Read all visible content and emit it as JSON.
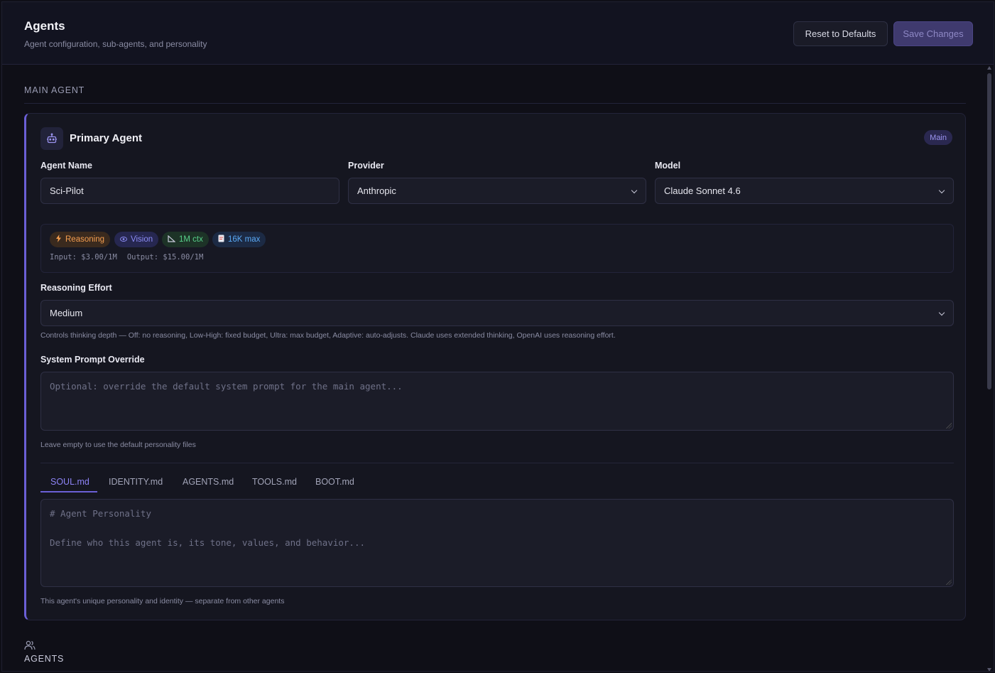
{
  "header": {
    "title": "Agents",
    "subtitle": "Agent configuration, sub-agents, and personality",
    "reset_label": "Reset to Defaults",
    "save_label": "Save Changes"
  },
  "main_section": {
    "label": "MAIN AGENT"
  },
  "primary_agent": {
    "title": "Primary Agent",
    "badge": "Main",
    "icon": "robot-icon",
    "name_label": "Agent Name",
    "name_value": "Sci-Pilot",
    "provider_label": "Provider",
    "provider_value": "Anthropic",
    "model_label": "Model",
    "model_value": "Claude Sonnet 4.6",
    "capabilities": {
      "reasoning": "Reasoning",
      "vision": "Vision",
      "context": "1M ctx",
      "max": "16K max",
      "input_price": "Input: $3.00/1M",
      "output_price": "Output: $15.00/1M"
    },
    "reasoning_label": "Reasoning Effort",
    "reasoning_value": "Medium",
    "reasoning_help": "Controls thinking depth — Off: no reasoning, Low-High: fixed budget, Ultra: max budget, Adaptive: auto-adjusts. Claude uses extended thinking, OpenAI uses reasoning effort.",
    "system_prompt_label": "System Prompt Override",
    "system_prompt_placeholder": "Optional: override the default system prompt for the main agent...",
    "system_prompt_help": "Leave empty to use the default personality files",
    "tabs": [
      "SOUL.md",
      "IDENTITY.md",
      "AGENTS.md",
      "TOOLS.md",
      "BOOT.md"
    ],
    "active_tab": "SOUL.md",
    "personality_placeholder_line1": "# Agent Personality",
    "personality_placeholder_line2": "Define who this agent is, its tone, values, and behavior...",
    "personality_help": "This agent's unique personality and identity — separate from other agents"
  },
  "agents_section": {
    "label": "AGENTS",
    "icon": "users-icon"
  },
  "colors": {
    "accent": "#6b5fd6",
    "background": "#0f0f17",
    "card": "#151620"
  }
}
